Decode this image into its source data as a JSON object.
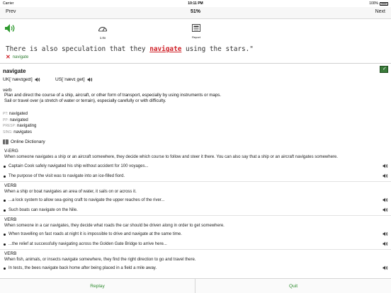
{
  "status": {
    "carrier": "Carrier",
    "time": "10:11 PM",
    "battery": "100%"
  },
  "nav": {
    "prev": "Prev",
    "title": "51%",
    "next": "Next"
  },
  "toolbar": {
    "speed": "1.0x",
    "report": "Report"
  },
  "sentence": {
    "before": "There is also speculation that they ",
    "target": "navigate",
    "after": " using the stars.\""
  },
  "answer": {
    "word": "navigate"
  },
  "entry": {
    "headword": "navigate",
    "uk": "UK[ˈnævɪgeɪt]",
    "us": "US[ˈnævɪˌget]",
    "pos": "verb",
    "defs": [
      "Plan and direct the course of a ship, aircraft, or other form of transport, especially by using instruments or maps.",
      "Sail or travel over (a stretch of water or terrain), especially carefully or with difficulty."
    ],
    "forms": [
      {
        "label": "PT:",
        "value": "navigated"
      },
      {
        "label": "PP:",
        "value": "navigated"
      },
      {
        "label": "PRESP:",
        "value": "navigating"
      },
      {
        "label": "SING:",
        "value": "navigates"
      }
    ],
    "online_title": "Online Dictionary"
  },
  "senses": [
    {
      "label": "V-ERG",
      "def": "When someone navigates a ship or an aircraft somewhere, they decide which course to follow and steer it there. You can also say that a ship or an aircraft navigates somewhere.",
      "examples": [
        "Captain Cook safely navigated his ship without accident for 100 voyages...",
        "The purpose of the visit was to navigate into an ice-filled fiord."
      ]
    },
    {
      "label": "VERB",
      "def": "When a ship or boat navigates an area of water, it sails on or across it.",
      "examples": [
        "...a lock system to allow sea-going craft to navigate the upper reaches of the river...",
        "Such boats can navigate on the Nile."
      ]
    },
    {
      "label": "VERB",
      "def": "When someone in a car navigates, they decide what roads the car should be driven along in order to get somewhere.",
      "examples": [
        "When travelling on fast roads at night it is impossible to drive and navigate at the same time.",
        "...the relief at successfully navigating across the Golden Gate Bridge to arrive here..."
      ]
    },
    {
      "label": "VERB",
      "def": "When fish, animals, or insects navigate somewhere, they find the right direction to go and travel there.",
      "examples": [
        "In tests, the bees navigate back home after being placed in a field a mile away."
      ]
    }
  ],
  "bottom": {
    "replay": "Replay",
    "quit": "Quit"
  },
  "colors": {
    "accent": "#2e8b2e",
    "error": "#d0242b"
  }
}
